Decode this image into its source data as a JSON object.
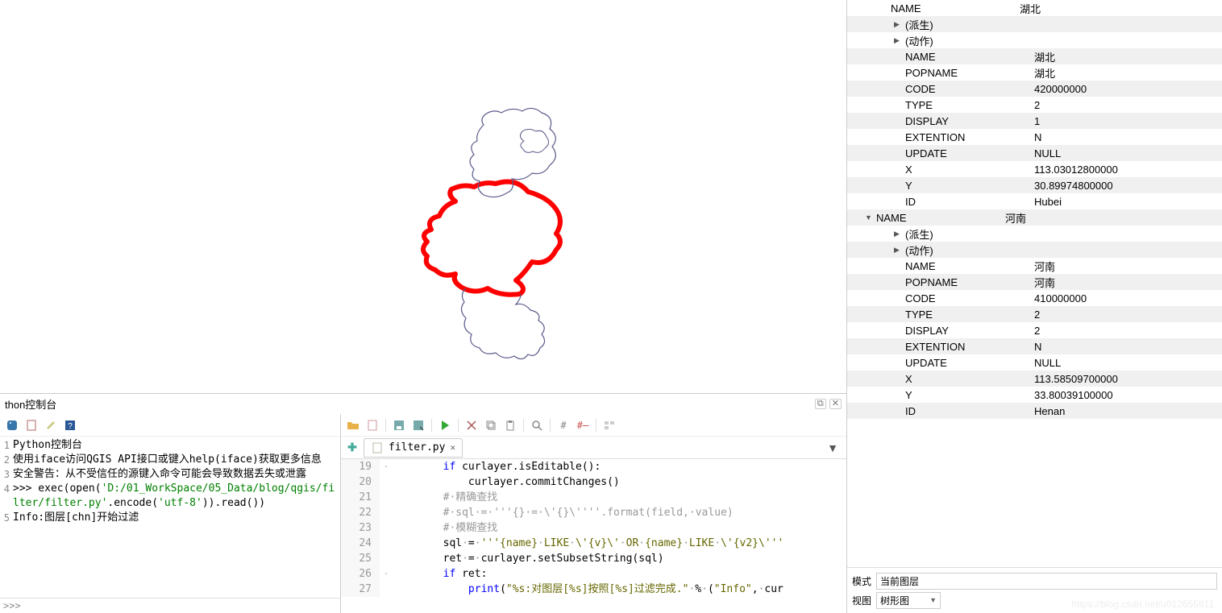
{
  "console": {
    "title": "thon控制台",
    "toolbar_icons": [
      "python-icon",
      "clear-icon",
      "settings-icon",
      "help-icon"
    ],
    "lines": [
      {
        "n": "1",
        "plain": "Python控制台"
      },
      {
        "n": "2",
        "plain": "使用iface访问QGIS API接口或键入help(iface)获取更多信息"
      },
      {
        "n": "3",
        "plain": "安全警告：从不受信任的源键入命令可能会导致数据丢失或泄露"
      },
      {
        "n": "4",
        "html": ">>> exec(open(<span class='str'>'D:/01_WorkSpace/05_Data/blog/qgis/filter/filter.py'</span>.encode(<span class='str'>'utf-8'</span>)).read())"
      },
      {
        "n": "5",
        "plain": "Info:图层[chn]开始过滤"
      }
    ],
    "prompt": ">>>"
  },
  "editor": {
    "tab_file": "filter.py",
    "lines": [
      {
        "n": "19",
        "fold": "-",
        "html": "        <span class='kw'>if</span> curlayer.isEditable():"
      },
      {
        "n": "20",
        "fold": "",
        "html": "            curlayer.commitChanges()"
      },
      {
        "n": "21",
        "fold": "",
        "html": "        <span class='cm'>#<span class='dot'>·</span>精确查找</span>"
      },
      {
        "n": "22",
        "fold": "",
        "html": "        <span class='cm'>#<span class='dot'>·</span>sql<span class='dot'>·</span>=<span class='dot'>·</span>'''{}<span class='dot'>·</span>=<span class='dot'>·</span>\\'{}\\''''.format(field,<span class='dot'>·</span>value)</span>"
      },
      {
        "n": "23",
        "fold": "",
        "html": "        <span class='cm'>#<span class='dot'>·</span>模糊查找</span>"
      },
      {
        "n": "24",
        "fold": "",
        "html": "        sql<span class='dot'>·</span>=<span class='dot'>·</span><span class='str2'>'''{name}<span class='dot'>·</span>LIKE<span class='dot'>·</span>\\'{v}\\'<span class='dot'>·</span>OR<span class='dot'>·</span>{name}<span class='dot'>·</span>LIKE<span class='dot'>·</span>\\'{v2}\\'''</span>"
      },
      {
        "n": "25",
        "fold": "",
        "html": "        ret<span class='dot'>·</span>=<span class='dot'>·</span>curlayer.setSubsetString(sql)"
      },
      {
        "n": "26",
        "fold": "-",
        "html": "        <span class='kw'>if</span> ret:"
      },
      {
        "n": "27",
        "fold": "",
        "html": "            <span class='kw'>print</span>(<span class='str2'>\"%s:对图层[%s]按照[%s]过滤完成.\"</span><span class='dot'>·</span>%<span class='dot'>·</span>(<span class='str2'>\"Info\"</span>,<span class='dot'>·</span>cur"
      }
    ]
  },
  "attributes": {
    "top_name": {
      "key": "NAME",
      "val": "湖北"
    },
    "hubei": {
      "derived": "(派生)",
      "actions": "(动作)",
      "fields": [
        {
          "k": "NAME",
          "v": "湖北"
        },
        {
          "k": "POPNAME",
          "v": "湖北"
        },
        {
          "k": "CODE",
          "v": "420000000"
        },
        {
          "k": "TYPE",
          "v": "2"
        },
        {
          "k": "DISPLAY",
          "v": "1"
        },
        {
          "k": "EXTENTION",
          "v": "N"
        },
        {
          "k": "UPDATE",
          "v": "NULL"
        },
        {
          "k": "X",
          "v": "113.03012800000"
        },
        {
          "k": "Y",
          "v": "30.89974800000"
        },
        {
          "k": "ID",
          "v": "Hubei"
        }
      ]
    },
    "henan_header": {
      "key": "NAME",
      "val": "河南"
    },
    "henan": {
      "derived": "(派生)",
      "actions": "(动作)",
      "fields": [
        {
          "k": "NAME",
          "v": "河南"
        },
        {
          "k": "POPNAME",
          "v": "河南"
        },
        {
          "k": "CODE",
          "v": "410000000"
        },
        {
          "k": "TYPE",
          "v": "2"
        },
        {
          "k": "DISPLAY",
          "v": "2"
        },
        {
          "k": "EXTENTION",
          "v": "N"
        },
        {
          "k": "UPDATE",
          "v": "NULL"
        },
        {
          "k": "X",
          "v": "113.58509700000"
        },
        {
          "k": "Y",
          "v": "33.80039100000"
        },
        {
          "k": "ID",
          "v": "Henan"
        }
      ]
    }
  },
  "footer": {
    "mode_label": "模式",
    "mode_value": "当前图层",
    "view_label": "视图",
    "view_value": "树形图"
  },
  "watermark": "https://blog.csdn.net/u012655811"
}
